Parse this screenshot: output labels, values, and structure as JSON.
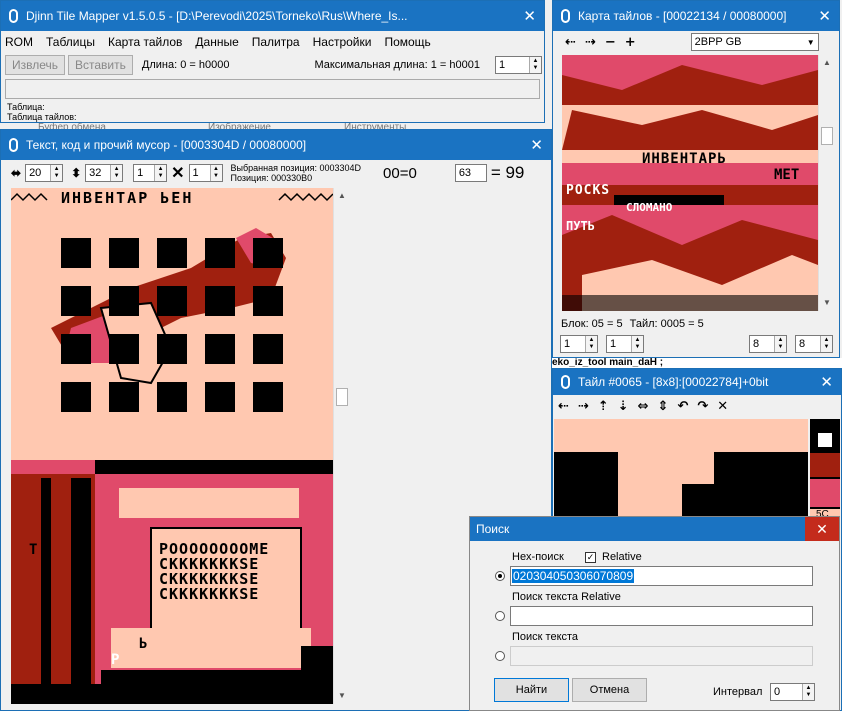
{
  "main_window": {
    "title": "Djinn Tile Mapper v1.5.0.5 - [D:\\Perevodi\\2025\\Torneko\\Rus\\Where_Is...",
    "menu": [
      "ROM",
      "Таблицы",
      "Карта тайлов",
      "Данные",
      "Палитра",
      "Настройки",
      "Помощь"
    ],
    "extract_label": "Извлечь",
    "insert_label": "Вставить",
    "length_text": "Длина: 0 = h0000",
    "maxlen_text": "Максимальная длина: 1 = h0001",
    "maxlen_value": "1",
    "table_label": "Таблица:",
    "tiletable_label": "Таблица тайлов:",
    "hidden_labels": [
      "Буфер обмена",
      "Изображение",
      "Инструменты"
    ]
  },
  "text_window": {
    "title": "Текст, код и прочий мусор - [0003304D / 00080000]",
    "width_value": "20",
    "height_value": "32",
    "v1": "1",
    "v2": "1",
    "selected_pos": "Выбранная позиция: 0003304D",
    "position": "Позиция: 000330B0",
    "hex_eq": "00=0",
    "code_value": "63",
    "code_result": "= 99",
    "title_text": "ИНВЕНТАР ЬЕН",
    "garbage_rows": [
      "РООООООООМЕ",
      "СКККККККSЕ",
      "СКККККККSЕ",
      "СКККККККSЕ"
    ],
    "letter_b": "Ь",
    "letter_p": "Р",
    "letter_t": "Т"
  },
  "tilemap_window": {
    "title": "Карта тайлов - [00022134 / 00080000]",
    "format": "2BPP GB",
    "menu_word": "ИНВЕНТАРЬ",
    "menu_word2": "МЕТ",
    "rocks": "РОСКS",
    "broken": "СЛОМАНО",
    "path": "ПУТЬ",
    "block_info": "Блок: 05 = 5",
    "tile_info": "Тайл: 0005 = 5",
    "s1": "1",
    "s2": "1",
    "s3": "8",
    "s4": "8",
    "behind_text": "eko_iz_tool main_daН ;"
  },
  "tile_window": {
    "title": "Тайл #0065 - [8x8]:[00022784]+0bit",
    "tools": [
      "⇠",
      "⇢",
      "⇡",
      "⇣",
      "⇔",
      "⇕",
      "↶",
      "↷",
      "✕"
    ],
    "palette_colors": [
      "#ffffff",
      "#a0200f",
      "#e04a6a",
      "#ffc8b0"
    ],
    "palette_tail": "5C"
  },
  "search_dialog": {
    "title": "Поиск",
    "hex_label": "Hex-поиск",
    "relative_label": "Relative",
    "hex_value": "020304050306070809",
    "text_rel_label": "Поиск текста Relative",
    "text_label": "Поиск текста",
    "find_label": "Найти",
    "cancel_label": "Отмена",
    "interval_label": "Интервал",
    "interval_value": "0"
  },
  "colors": {
    "titlebar": "#1a73c2",
    "pink_bg": "#ffc8b0",
    "dark_red": "#a0200f",
    "rose": "#e04a6a",
    "black": "#000000"
  }
}
